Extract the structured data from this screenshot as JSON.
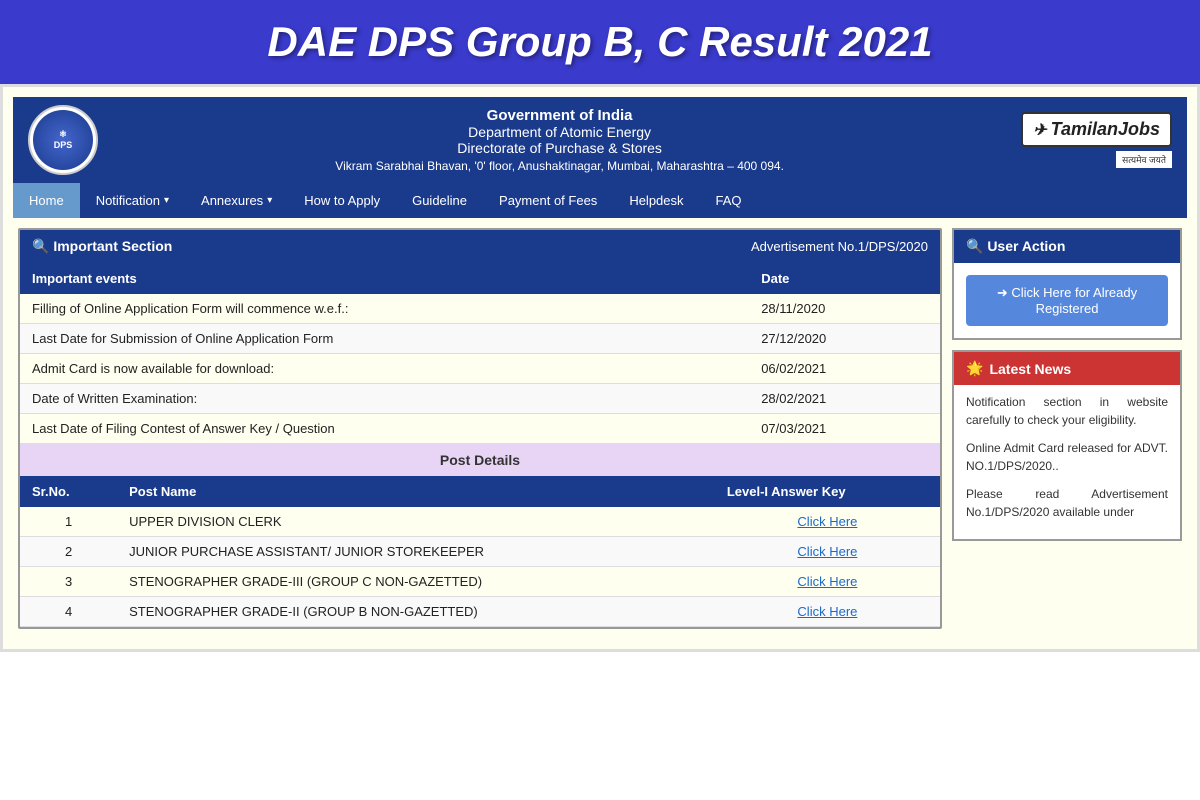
{
  "mainTitle": "DAE DPS Group B, C Result 2021",
  "header": {
    "govLine1": "Government of India",
    "govLine2": "Department of Atomic Energy",
    "govLine3": "Directorate of Purchase & Stores",
    "govLine4": "Vikram Sarabhai Bhavan, '0' floor, Anushaktinagar, Mumbai, Maharashtra – 400 094.",
    "logoText": "DPS",
    "tamilanJobsLabel": "TamilanJobs",
    "satyamevLabel": "सत्यमेव जयते"
  },
  "nav": {
    "items": [
      {
        "label": "Home",
        "active": true,
        "hasDropdown": false
      },
      {
        "label": "Notification",
        "active": false,
        "hasDropdown": true
      },
      {
        "label": "Annexures",
        "active": false,
        "hasDropdown": true
      },
      {
        "label": "How to Apply",
        "active": false,
        "hasDropdown": false
      },
      {
        "label": "Guideline",
        "active": false,
        "hasDropdown": false
      },
      {
        "label": "Payment of Fees",
        "active": false,
        "hasDropdown": false
      },
      {
        "label": "Helpdesk",
        "active": false,
        "hasDropdown": false
      },
      {
        "label": "FAQ",
        "active": false,
        "hasDropdown": false
      }
    ]
  },
  "importantSection": {
    "title": "🔍 Important Section",
    "advNo": "Advertisement No.1/DPS/2020",
    "tableHeaders": [
      "Important events",
      "Date"
    ],
    "rows": [
      {
        "event": "Filling of Online Application Form will commence w.e.f.:",
        "date": "28/11/2020"
      },
      {
        "event": "Last Date for Submission of Online Application Form",
        "date": "27/12/2020"
      },
      {
        "event": "Admit Card is now available for download:",
        "date": "06/02/2021"
      },
      {
        "event": "Date of Written Examination:",
        "date": "28/02/2021"
      },
      {
        "event": "Last Date of Filing Contest of Answer Key / Question",
        "date": "07/03/2021"
      }
    ],
    "postDetailsTitle": "Post Details",
    "postHeaders": [
      "Sr.No.",
      "Post Name",
      "Level-I Answer Key"
    ],
    "posts": [
      {
        "srNo": "1",
        "name": "UPPER DIVISION CLERK",
        "link": "Click Here"
      },
      {
        "srNo": "2",
        "name": "JUNIOR PURCHASE ASSISTANT/ JUNIOR STOREKEEPER",
        "link": "Click Here"
      },
      {
        "srNo": "3",
        "name": "STENOGRAPHER GRADE-III (GROUP C NON-GAZETTED)",
        "link": "Click Here"
      },
      {
        "srNo": "4",
        "name": "STENOGRAPHER GRADE-II (GROUP B NON-GAZETTED)",
        "link": "Click Here"
      }
    ]
  },
  "userAction": {
    "title": "🔍 User Action",
    "registerBtnLabel": "➜ Click Here for Already Registered"
  },
  "latestNews": {
    "title": "Latest News",
    "items": [
      "Notification section in website carefully to check your eligibility.",
      "Online Admit Card released for ADVT. NO.1/DPS/2020..",
      "Please read Advertisement No.1/DPS/2020 available under"
    ]
  }
}
